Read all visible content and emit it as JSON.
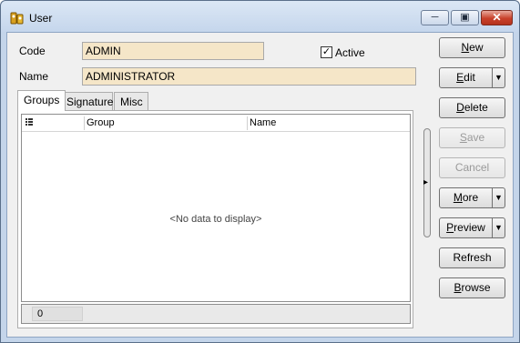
{
  "window": {
    "title": "User"
  },
  "form": {
    "code_label": "Code",
    "code_value": "ADMIN",
    "name_label": "Name",
    "name_value": "ADMINISTRATOR",
    "active_label": "Active",
    "active_checked": true
  },
  "tabs": [
    {
      "label": "Groups",
      "active": true
    },
    {
      "label": "Signature",
      "active": false
    },
    {
      "label": "Misc",
      "active": false
    }
  ],
  "grid": {
    "columns": [
      "Group",
      "Name"
    ],
    "empty_text": "<No data to display>",
    "footer_count": "0"
  },
  "buttons": {
    "new": {
      "label": "New",
      "mnemonic": "N",
      "enabled": true
    },
    "edit": {
      "label": "Edit",
      "mnemonic": "E",
      "enabled": true
    },
    "delete": {
      "label": "Delete",
      "mnemonic": "D",
      "enabled": true
    },
    "save": {
      "label": "Save",
      "mnemonic": "S",
      "enabled": false
    },
    "cancel": {
      "label": "Cancel",
      "enabled": false
    },
    "more": {
      "label": "More",
      "mnemonic": "M",
      "enabled": true
    },
    "preview": {
      "label": "Preview",
      "mnemonic": "P",
      "enabled": true
    },
    "refresh": {
      "label": "Refresh",
      "enabled": true
    },
    "browse": {
      "label": "Browse",
      "mnemonic": "B",
      "enabled": true
    }
  },
  "icons": {
    "app": "user-keys-icon",
    "minimize": "minimize-icon",
    "maximize": "maximize-icon",
    "close": "close-icon",
    "column_chooser": "column-chooser-icon",
    "dropdown": "chevron-down-icon",
    "splitter": "chevron-right-icon"
  },
  "colors": {
    "field_background": "#f5e6c8",
    "close_button": "#c8412b"
  }
}
